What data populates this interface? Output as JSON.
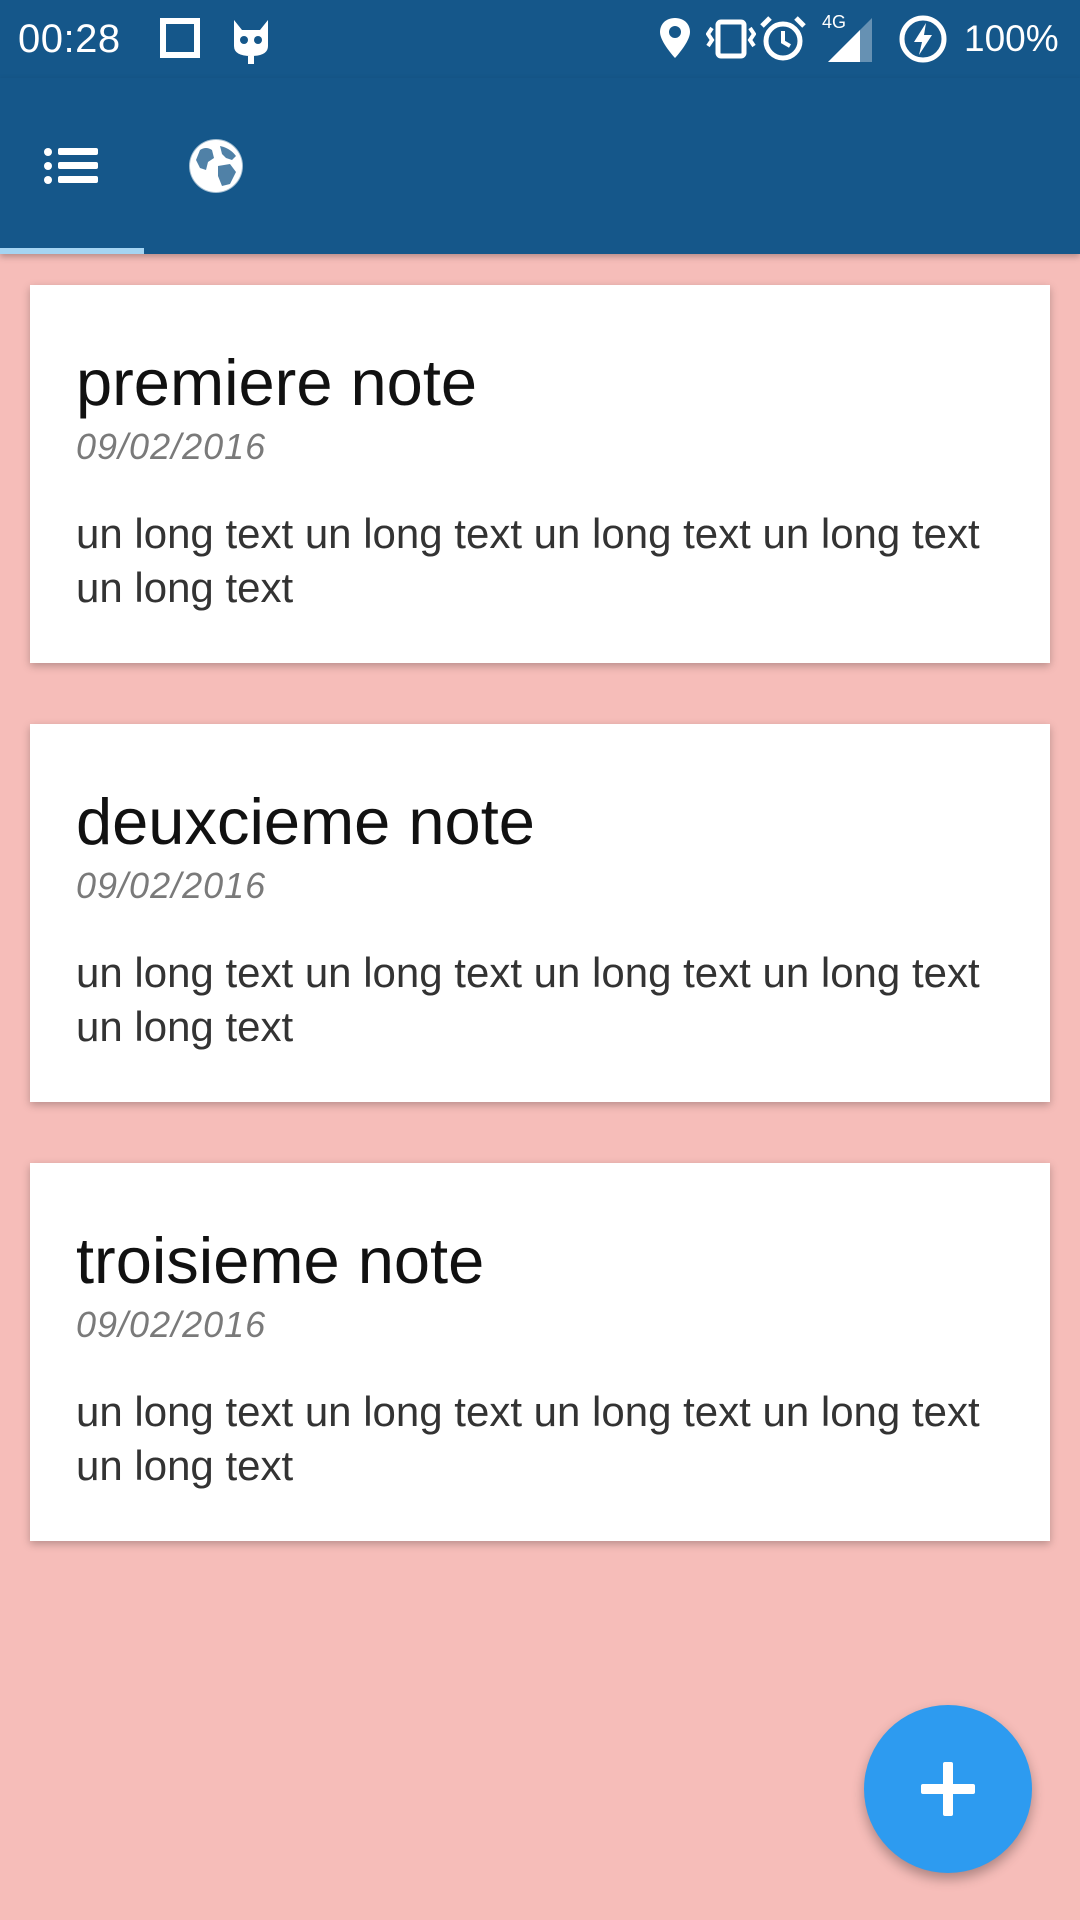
{
  "status_bar": {
    "time": "00:28",
    "battery": "100%",
    "network": "4G",
    "icons": [
      "square-icon",
      "android-mascot-icon",
      "location-pin-icon",
      "vibrate-icon",
      "alarm-icon",
      "signal-4g-icon",
      "battery-charging-icon"
    ]
  },
  "tabs": [
    {
      "icon": "list-icon",
      "selected": true
    },
    {
      "icon": "globe-icon",
      "selected": false
    }
  ],
  "notes": [
    {
      "title": "premiere note",
      "date": "09/02/2016",
      "body": "un long text un long text un long text un long text un long text"
    },
    {
      "title": "deuxcieme note",
      "date": "09/02/2016",
      "body": "un long text un long text un long text un long text un long text"
    },
    {
      "title": "troisieme note",
      "date": "09/02/2016",
      "body": "un long text un long text un long text un long text un long text"
    }
  ],
  "fab": {
    "icon": "plus-icon"
  },
  "colors": {
    "app_bar": "#15578a",
    "background": "#f6bdb9",
    "tab_indicator": "#a5d4f2",
    "fab": "#2d9bf0"
  }
}
